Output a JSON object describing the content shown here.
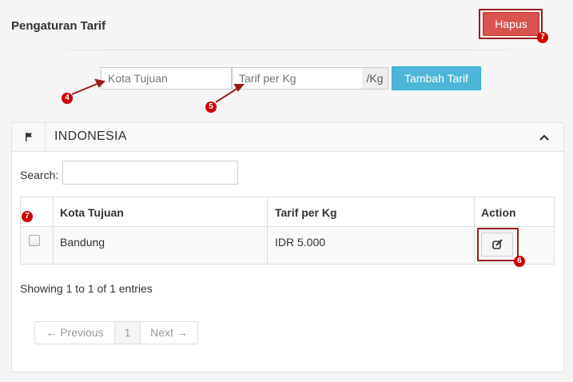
{
  "header": {
    "title": "Pengaturan Tarif",
    "delete_label": "Hapus"
  },
  "form": {
    "city_placeholder": "Kota Tujuan",
    "rate_placeholder": "Tarif per Kg",
    "unit_addon": "/Kg",
    "add_label": "Tambah Tarif"
  },
  "panel": {
    "title": "INDONESIA",
    "search_label": "Search:",
    "search_value": "",
    "columns": [
      "",
      "Kota Tujuan",
      "Tarif per Kg",
      "Action"
    ],
    "rows": [
      {
        "city": "Bandung",
        "rate": "IDR 5.000"
      }
    ],
    "info": "Showing 1 to 1 of 1 entries",
    "pagination": {
      "prev": "← Previous",
      "page": "1",
      "next": "Next →"
    }
  },
  "markers": [
    "4",
    "5",
    "6",
    "7",
    "7"
  ],
  "colors": {
    "danger": "#d9534f",
    "info": "#4db6d8",
    "marker": "#cc0000"
  }
}
